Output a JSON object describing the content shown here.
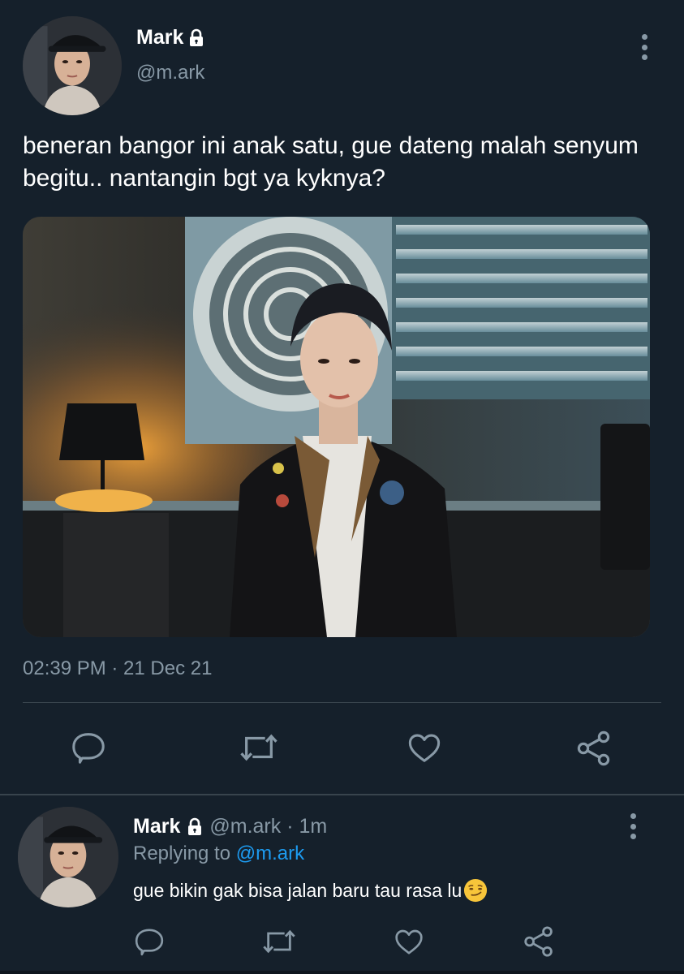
{
  "tweet": {
    "author": {
      "name": "Mark",
      "handle": "@m.ark",
      "protected": true
    },
    "text": "beneran bangor ini anak satu, gue dateng malah senyum begitu.. nantangin bgt ya kyknya?",
    "timestamp": "02:39 PM · 21 Dec 21",
    "actions": [
      "reply-icon",
      "retweet-icon",
      "like-icon",
      "share-icon"
    ]
  },
  "reply": {
    "author": {
      "name": "Mark",
      "handle": "@m.ark",
      "protected": true
    },
    "meta": "@m.ark · 1m",
    "replying_prefix": "Replying to",
    "replying_to": "@m.ark",
    "text": "gue bikin gak bisa jalan baru tau rasa lu",
    "emoji": "smirking-face",
    "actions": [
      "reply-icon",
      "retweet-icon",
      "like-icon",
      "share-icon"
    ]
  },
  "colors": {
    "background": "#15202b",
    "secondary_text": "#8899a6",
    "link": "#1d9bf0",
    "divider": "#38444d"
  }
}
